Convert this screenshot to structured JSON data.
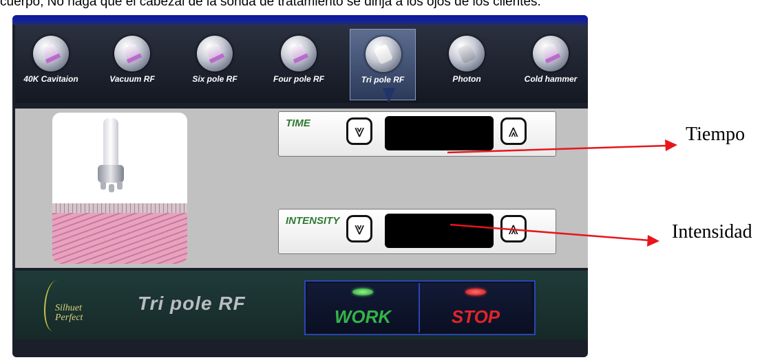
{
  "caption": "cuerpo, No haga que el cabezal de la sonda de tratamiento se dirija a los ojos de los clientes.",
  "toolbar": {
    "tools": [
      {
        "label": "40K Cavitaion",
        "icon": "cavitation-probe-icon"
      },
      {
        "label": "Vacuum RF",
        "icon": "vacuum-rf-probe-icon"
      },
      {
        "label": "Six pole RF",
        "icon": "six-pole-rf-probe-icon"
      },
      {
        "label": "Four pole RF",
        "icon": "four-pole-rf-probe-icon"
      },
      {
        "label": "Tri pole RF",
        "icon": "tri-pole-rf-probe-icon",
        "selected": true
      },
      {
        "label": "Photon",
        "icon": "photon-probe-icon"
      },
      {
        "label": "Cold hammer",
        "icon": "cold-hammer-probe-icon"
      }
    ]
  },
  "controls": {
    "time": {
      "label": "TIME",
      "down": "down-arrow-icon",
      "up": "up-arrow-icon",
      "value": ""
    },
    "intensity": {
      "label": "INTENSITY",
      "down": "down-arrow-icon",
      "up": "up-arrow-icon",
      "value": ""
    }
  },
  "footer": {
    "logo_text": "Silhuet\nPerfect",
    "mode_title": "Tri pole RF",
    "work_label": "WORK",
    "stop_label": "STOP"
  },
  "annotations": {
    "time": "Tiempo",
    "intensity": "Intensidad"
  },
  "colors": {
    "panel": "#1b1f29",
    "content": "#c1c1c1",
    "label_green": "#2e7a32",
    "work_green": "#33b448",
    "stop_red": "#e0252a",
    "arrow_red": "#e8151b"
  }
}
